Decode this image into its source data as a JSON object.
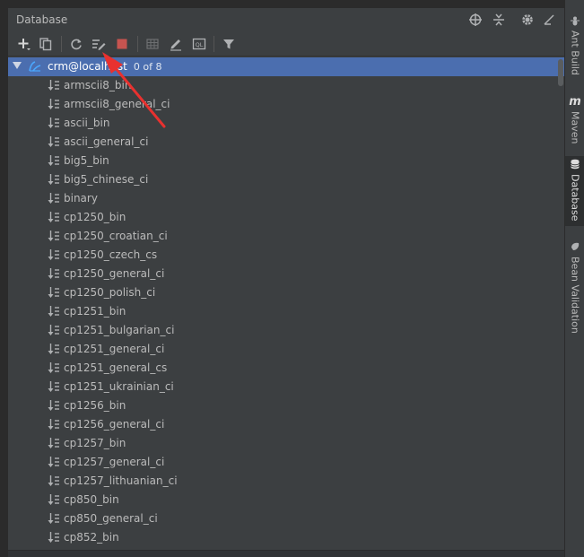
{
  "panel": {
    "title": "Database"
  },
  "header_icons": [
    "crosshair-icon",
    "collapse-all-icon",
    "gear-icon",
    "minimize-icon"
  ],
  "toolbar": {
    "buttons": [
      {
        "name": "add-icon"
      },
      {
        "name": "copy-icon"
      },
      {
        "name": "refresh-icon"
      },
      {
        "name": "properties-icon"
      },
      {
        "name": "stop-icon"
      },
      {
        "name": "table-view-icon"
      },
      {
        "name": "edit-icon"
      },
      {
        "name": "console-icon",
        "text": "QL"
      },
      {
        "name": "filter-icon"
      }
    ]
  },
  "tree": {
    "datasource": {
      "label": "crm@localhost",
      "count": "0 of 8"
    },
    "items": [
      "armscii8_bin",
      "armscii8_general_ci",
      "ascii_bin",
      "ascii_general_ci",
      "big5_bin",
      "big5_chinese_ci",
      "binary",
      "cp1250_bin",
      "cp1250_croatian_ci",
      "cp1250_czech_cs",
      "cp1250_general_ci",
      "cp1250_polish_ci",
      "cp1251_bin",
      "cp1251_bulgarian_ci",
      "cp1251_general_ci",
      "cp1251_general_cs",
      "cp1251_ukrainian_ci",
      "cp1256_bin",
      "cp1256_general_ci",
      "cp1257_bin",
      "cp1257_general_ci",
      "cp1257_lithuanian_ci",
      "cp850_bin",
      "cp850_general_ci",
      "cp852_bin"
    ]
  },
  "side_tabs": [
    {
      "label": "Ant Build",
      "icon": "ant-icon",
      "active": false
    },
    {
      "label": "Maven",
      "icon": "maven-icon",
      "glyph": "m",
      "active": false
    },
    {
      "label": "Database",
      "icon": "database-icon",
      "active": true
    },
    {
      "label": "Bean Validation",
      "icon": "bean-validation-icon",
      "active": false
    }
  ],
  "colors": {
    "background": "#3c3f41",
    "selection": "#4b6eaf",
    "text": "#bbbbbb",
    "stop": "#c75450",
    "annotation_arrow": "#e8312f"
  }
}
